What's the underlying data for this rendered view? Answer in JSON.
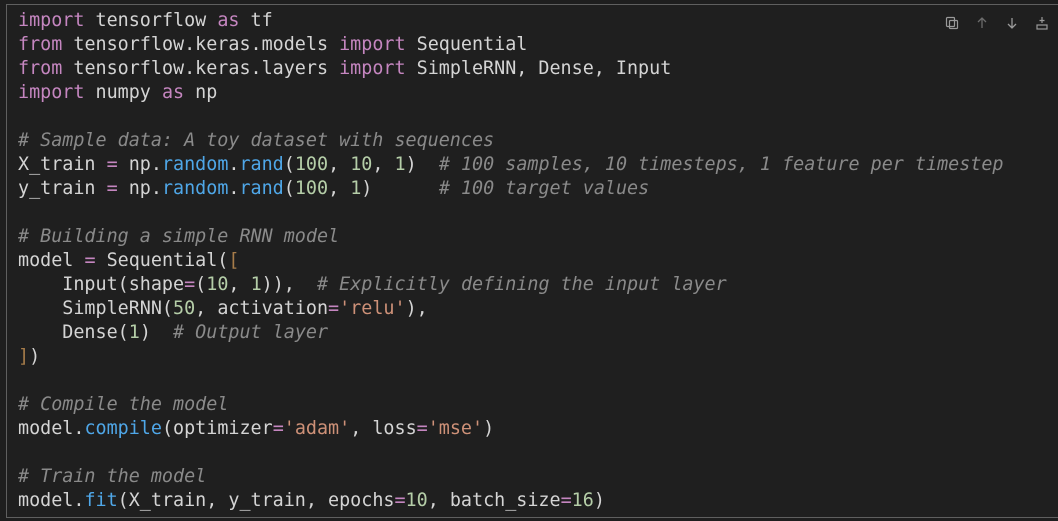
{
  "toolbar": {
    "icons": [
      "copy-icon",
      "move-up-icon",
      "move-down-icon",
      "insert-below-icon"
    ]
  },
  "code": {
    "lines": [
      [
        {
          "t": "import",
          "c": "kw"
        },
        {
          "t": " tensorflow ",
          "c": ""
        },
        {
          "t": "as",
          "c": "kw"
        },
        {
          "t": " tf",
          "c": ""
        }
      ],
      [
        {
          "t": "from",
          "c": "kw"
        },
        {
          "t": " tensorflow.keras.models ",
          "c": ""
        },
        {
          "t": "import",
          "c": "kw"
        },
        {
          "t": " Sequential",
          "c": ""
        }
      ],
      [
        {
          "t": "from",
          "c": "kw"
        },
        {
          "t": " tensorflow.keras.layers ",
          "c": ""
        },
        {
          "t": "import",
          "c": "kw"
        },
        {
          "t": " SimpleRNN, Dense, Input",
          "c": ""
        }
      ],
      [
        {
          "t": "import",
          "c": "kw"
        },
        {
          "t": " numpy ",
          "c": ""
        },
        {
          "t": "as",
          "c": "kw"
        },
        {
          "t": " np",
          "c": ""
        }
      ],
      [],
      [
        {
          "t": "# Sample data: A toy dataset with sequences",
          "c": "cm"
        }
      ],
      [
        {
          "t": "X_train ",
          "c": ""
        },
        {
          "t": "=",
          "c": "op"
        },
        {
          "t": " np.",
          "c": ""
        },
        {
          "t": "random",
          "c": "fn"
        },
        {
          "t": ".",
          "c": ""
        },
        {
          "t": "rand",
          "c": "fn"
        },
        {
          "t": "(",
          "c": ""
        },
        {
          "t": "100",
          "c": "num"
        },
        {
          "t": ", ",
          "c": ""
        },
        {
          "t": "10",
          "c": "num"
        },
        {
          "t": ", ",
          "c": ""
        },
        {
          "t": "1",
          "c": "num"
        },
        {
          "t": ")  ",
          "c": ""
        },
        {
          "t": "# 100 samples, 10 timesteps, 1 feature per timestep",
          "c": "cm"
        }
      ],
      [
        {
          "t": "y_train ",
          "c": ""
        },
        {
          "t": "=",
          "c": "op"
        },
        {
          "t": " np.",
          "c": ""
        },
        {
          "t": "random",
          "c": "fn"
        },
        {
          "t": ".",
          "c": ""
        },
        {
          "t": "rand",
          "c": "fn"
        },
        {
          "t": "(",
          "c": ""
        },
        {
          "t": "100",
          "c": "num"
        },
        {
          "t": ", ",
          "c": ""
        },
        {
          "t": "1",
          "c": "num"
        },
        {
          "t": ")      ",
          "c": ""
        },
        {
          "t": "# 100 target values",
          "c": "cm"
        }
      ],
      [],
      [
        {
          "t": "# Building a simple RNN model",
          "c": "cm"
        }
      ],
      [
        {
          "t": "model ",
          "c": ""
        },
        {
          "t": "=",
          "c": "op"
        },
        {
          "t": " Sequential(",
          "c": ""
        },
        {
          "t": "[",
          "c": "br"
        }
      ],
      [
        {
          "t": "    Input(shape",
          "c": ""
        },
        {
          "t": "=",
          "c": "op"
        },
        {
          "t": "(",
          "c": ""
        },
        {
          "t": "10",
          "c": "num"
        },
        {
          "t": ", ",
          "c": ""
        },
        {
          "t": "1",
          "c": "num"
        },
        {
          "t": ")),  ",
          "c": ""
        },
        {
          "t": "# Explicitly defining the input layer",
          "c": "cm"
        }
      ],
      [
        {
          "t": "    SimpleRNN(",
          "c": ""
        },
        {
          "t": "50",
          "c": "num"
        },
        {
          "t": ", activation",
          "c": ""
        },
        {
          "t": "=",
          "c": "op"
        },
        {
          "t": "'relu'",
          "c": "str"
        },
        {
          "t": "),",
          "c": ""
        }
      ],
      [
        {
          "t": "    Dense(",
          "c": ""
        },
        {
          "t": "1",
          "c": "num"
        },
        {
          "t": ")  ",
          "c": ""
        },
        {
          "t": "# Output layer",
          "c": "cm"
        }
      ],
      [
        {
          "t": "]",
          "c": "br"
        },
        {
          "t": ")",
          "c": ""
        }
      ],
      [],
      [
        {
          "t": "# Compile the model",
          "c": "cm"
        }
      ],
      [
        {
          "t": "model.",
          "c": ""
        },
        {
          "t": "compile",
          "c": "fn"
        },
        {
          "t": "(optimizer",
          "c": ""
        },
        {
          "t": "=",
          "c": "op"
        },
        {
          "t": "'adam'",
          "c": "str"
        },
        {
          "t": ", loss",
          "c": ""
        },
        {
          "t": "=",
          "c": "op"
        },
        {
          "t": "'mse'",
          "c": "str"
        },
        {
          "t": ")",
          "c": ""
        }
      ],
      [],
      [
        {
          "t": "# Train the model",
          "c": "cm"
        }
      ],
      [
        {
          "t": "model.",
          "c": ""
        },
        {
          "t": "fit",
          "c": "fn"
        },
        {
          "t": "(X_train, y_train, epochs",
          "c": ""
        },
        {
          "t": "=",
          "c": "op"
        },
        {
          "t": "10",
          "c": "num"
        },
        {
          "t": ", batch_size",
          "c": ""
        },
        {
          "t": "=",
          "c": "op"
        },
        {
          "t": "16",
          "c": "num"
        },
        {
          "t": ")",
          "c": ""
        }
      ]
    ]
  }
}
